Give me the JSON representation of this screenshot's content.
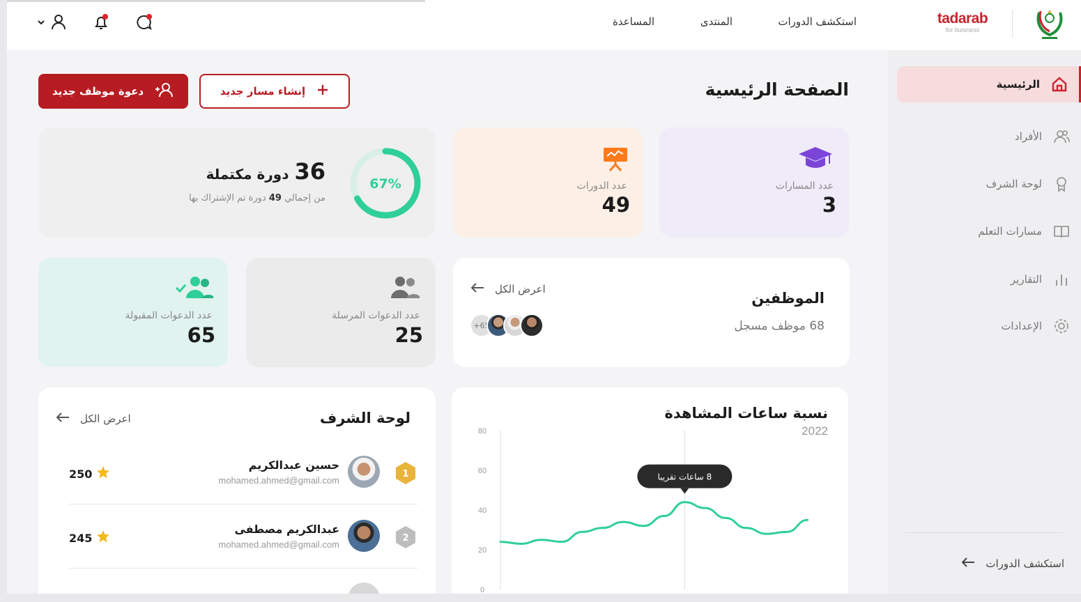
{
  "header": {
    "brand": "tadarab",
    "brand_sub": "for business",
    "nav": [
      "استكشف الدورات",
      "المنتدى",
      "المساعدة"
    ],
    "icons": [
      "chat-icon",
      "bell-icon",
      "user-icon",
      "chevron-down-icon"
    ]
  },
  "sidebar": {
    "items": [
      {
        "label": "الرئيسية",
        "icon": "home-icon",
        "active": true
      },
      {
        "label": "الأفراد",
        "icon": "users-icon",
        "active": false
      },
      {
        "label": "لوحة الشرف",
        "icon": "award-icon",
        "active": false
      },
      {
        "label": "مسارات التعلم",
        "icon": "book-icon",
        "active": false
      },
      {
        "label": "التقارير",
        "icon": "bar-chart-icon",
        "active": false
      },
      {
        "label": "الإعدادات",
        "icon": "gear-icon",
        "active": false
      }
    ],
    "bottom_link": "استكشف الدورات"
  },
  "main": {
    "title": "الصفحة الرئيسية",
    "buttons": {
      "create_path": "إنشاء مسار جديد",
      "invite": "دعوة موظف جديد"
    },
    "stats": {
      "paths_label": "عدد المسارات",
      "paths_value": "3",
      "courses_label": "عدد الدورات",
      "courses_value": "49",
      "completed_count": "36",
      "completed_label": "دورة مكتملة",
      "completed_sub_before": "من إجمالي",
      "completed_sub_total": "49",
      "completed_sub_after": "دورة تم الإشتراك بها",
      "completed_percent": "67%",
      "completed_fraction": 0.67,
      "sent_label": "عدد الدعوات المرسلة",
      "sent_value": "25",
      "accepted_label": "عدد الدعوات المقبولة",
      "accepted_value": "65"
    },
    "employees": {
      "title": "الموظفين",
      "count_text": "68 موظف مسجل",
      "view_all": "اعرض الكل",
      "more_badge": "+65"
    },
    "watch_chart": {
      "title": "نسبة ساعات المشاهدة",
      "year": "2022",
      "tooltip": "8 ساعات تقريبا"
    },
    "leaderboard": {
      "title": "لوحة الشرف",
      "view_all": "اعرض الكل",
      "rows": [
        {
          "rank": "1",
          "name": "حسين عبدالكريم",
          "email": "mohamed.ahmed@gmail.com",
          "score": "250"
        },
        {
          "rank": "2",
          "name": "عبدالكريم مصطفى",
          "email": "mohamed.ahmed@gmail.com",
          "score": "245"
        }
      ]
    }
  },
  "chart_data": {
    "type": "line",
    "title": "نسبة ساعات المشاهدة",
    "subtitle": "2022",
    "yticks": [
      "80",
      "60",
      "40",
      "20",
      "0"
    ],
    "ylim": [
      0,
      80
    ],
    "xlim": [
      0,
      16
    ],
    "highlight_x": 9,
    "series": [
      {
        "values": [
          [
            0,
            24
          ],
          [
            1,
            23
          ],
          [
            2,
            25
          ],
          [
            3,
            24
          ],
          [
            4,
            29
          ],
          [
            5,
            31
          ],
          [
            6,
            34
          ],
          [
            7,
            32
          ],
          [
            8,
            37
          ],
          [
            9,
            44
          ],
          [
            10,
            41
          ],
          [
            11,
            36
          ],
          [
            12,
            31
          ],
          [
            13,
            28
          ],
          [
            14,
            29
          ],
          [
            15,
            35
          ]
        ]
      }
    ],
    "colors": {
      "line": "#2fcf98",
      "tooltip_bg": "#2a2a2a",
      "grid": "#e9e9e9"
    }
  },
  "colors": {
    "primary": "#b71c22",
    "accent_green": "#2fcf98",
    "paths_icon": "#7b46d8",
    "courses_icon": "#ff7a1a",
    "gold": "#e8b43a",
    "silver": "#bdbdbd"
  }
}
